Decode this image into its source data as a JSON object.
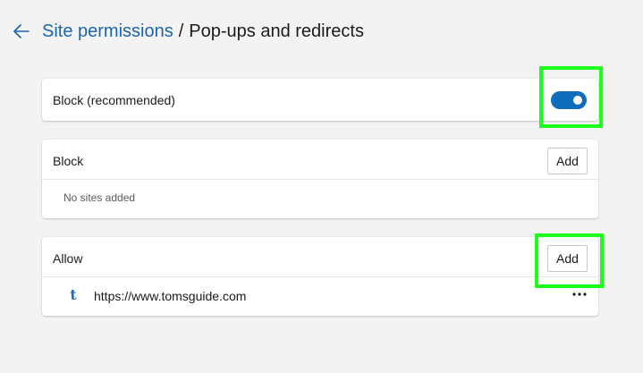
{
  "header": {
    "back_icon": "arrow-left-icon",
    "breadcrumb_link": "Site permissions",
    "separator": "/",
    "current_page": "Pop-ups and redirects"
  },
  "toggle_card": {
    "label": "Block (recommended)",
    "toggle_state": "on"
  },
  "block_card": {
    "title": "Block",
    "add_label": "Add",
    "empty_text": "No sites added"
  },
  "allow_card": {
    "title": "Allow",
    "add_label": "Add",
    "sites": [
      {
        "icon": "t",
        "url": "https://www.tomsguide.com",
        "more_icon": "more-horizontal-icon"
      }
    ]
  },
  "colors": {
    "accent": "#0f6cbd",
    "link": "#1a65b0",
    "highlight": "#1bff1b",
    "background": "#f3f3f3"
  }
}
